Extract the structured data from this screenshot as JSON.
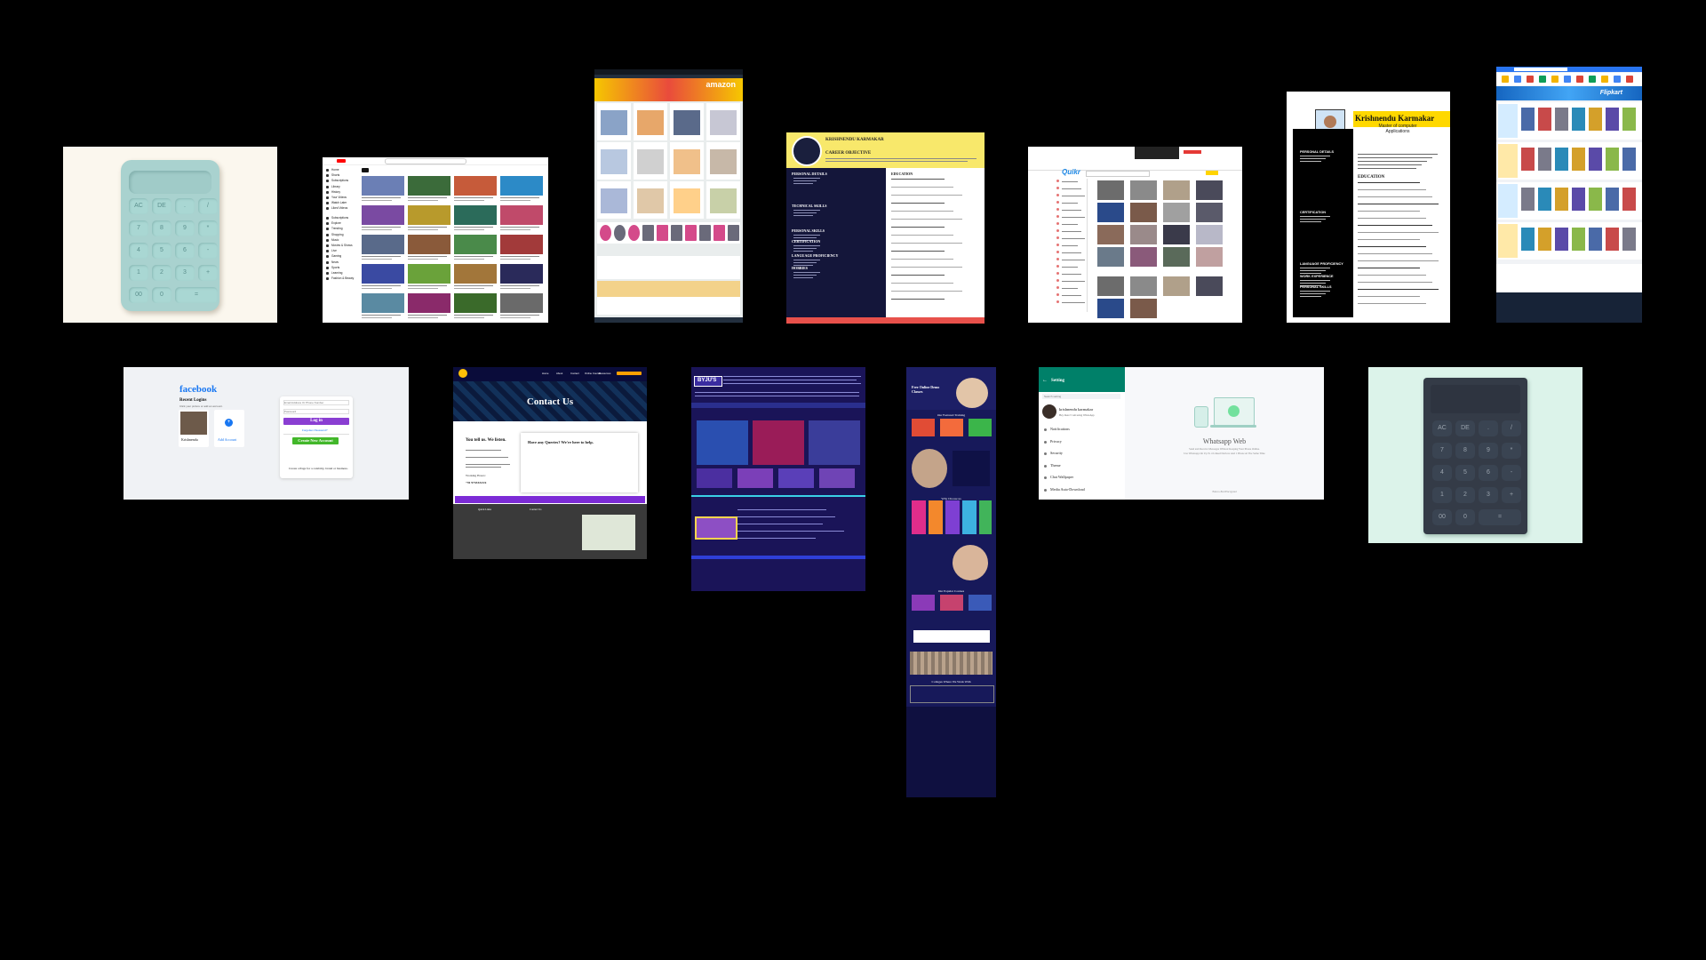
{
  "cards": {
    "calc_light": {
      "keys": [
        "AC",
        "DE",
        ".",
        "/",
        "7",
        "8",
        "9",
        "*",
        "4",
        "5",
        "6",
        "-",
        "1",
        "2",
        "3",
        "+",
        "00",
        "0",
        "="
      ],
      "colors": {
        "bg": "#fbf7ee",
        "body": "#a9d2cf"
      }
    },
    "youtube": {
      "sidebar": [
        "Home",
        "Shorts",
        "Subscriptions",
        "Library",
        "History",
        "Your Videos",
        "Watch Later",
        "Liked Videos",
        "Subscriptions",
        "Explore",
        "Trending",
        "Shopping",
        "Music",
        "Movies & Shows",
        "Live",
        "Gaming",
        "News",
        "Sports",
        "Learning",
        "Fashion & Beauty"
      ]
    },
    "amazon": {
      "logo": "amazon"
    },
    "resume_dark": {
      "name": "KRISHNENDU KARMAKAR",
      "career": "CAREER OBJECTIVE",
      "left_sections": [
        "PERSONAL DETAILS",
        "TECHNICAL SKILLS",
        "PERSONAL SKILLS",
        "CERTIFICATION",
        "LANGUAGE PROFICIENCY",
        "HOBBIES"
      ],
      "right_sections": [
        "EDUCATION"
      ]
    },
    "quikr": {
      "logo": "Quikr"
    },
    "resume_light": {
      "name": "Krishnendu Karmakar",
      "title": "Master of computer Applications",
      "sections": [
        "PERSONAL DETAILS",
        "CERTIFICATION",
        "LANGUAGE PROFICIENCY",
        "WORK EXPERIENCE",
        "PERSONAL SKILLS",
        "EDUCATION"
      ]
    },
    "flipkart": {
      "logo": "Flipkart"
    },
    "facebook": {
      "logo": "facebook",
      "recent": "Recent Logins",
      "recent_sub": "Click your picture or add an account.",
      "user": "Krishnendu",
      "add": "Add Account",
      "email_placeholder": "Email Address Or Phone Number",
      "password_placeholder": "Password",
      "login": "Log in",
      "forgot": "Forgotten Password?",
      "create": "Create New Account",
      "page_text": "Create a Page for a celebrity, brand or business."
    },
    "contact": {
      "title": "Contact Us",
      "nav": [
        "Home",
        "About",
        "Contact",
        "Online Course",
        "Resources"
      ],
      "left_heading": "You tell us. We listen.",
      "right_heading": "Have any Queries? We're here to help.",
      "working": "Working Hours:",
      "phone": "+91 9733XXXX",
      "footer_left": "Quick Links",
      "footer_mid": "Contact Us"
    },
    "byjus": {
      "logo": "BYJU'S"
    },
    "tutorial": {
      "heading": "Free Online Demo Classes",
      "sections": [
        "Our Featured Training",
        "Why Choose us",
        "Our Popular Courses",
        "Colleges Where We Work With"
      ]
    },
    "whatsapp": {
      "header": "Setting",
      "search_placeholder": "Search setting",
      "user": "krishnendu karmakar",
      "user_status": "Hey there! I am using WhatsApp",
      "menu": [
        "Notifications",
        "Privacy",
        "Security",
        "Theme",
        "Chat Wallpaper",
        "Media Auto-Download"
      ],
      "title": "Whatsapp Web",
      "desc1": "Send and Receive Messages Without Keeping Your Phone Online.",
      "desc2": "Use Whatsapp On Up To 4 Linked Devices And 1 Phone At The Same Time",
      "footer": "End-to-End Encrypted",
      "colors": {
        "header": "#008069",
        "accent": "#25d366"
      }
    },
    "calc_dark": {
      "keys": [
        "AC",
        "DE",
        ".",
        "/",
        "7",
        "8",
        "9",
        "*",
        "4",
        "5",
        "6",
        "-",
        "1",
        "2",
        "3",
        "+",
        "00",
        "0",
        "="
      ],
      "colors": {
        "bg": "#dcf3ea",
        "body": "#343b47"
      }
    }
  }
}
